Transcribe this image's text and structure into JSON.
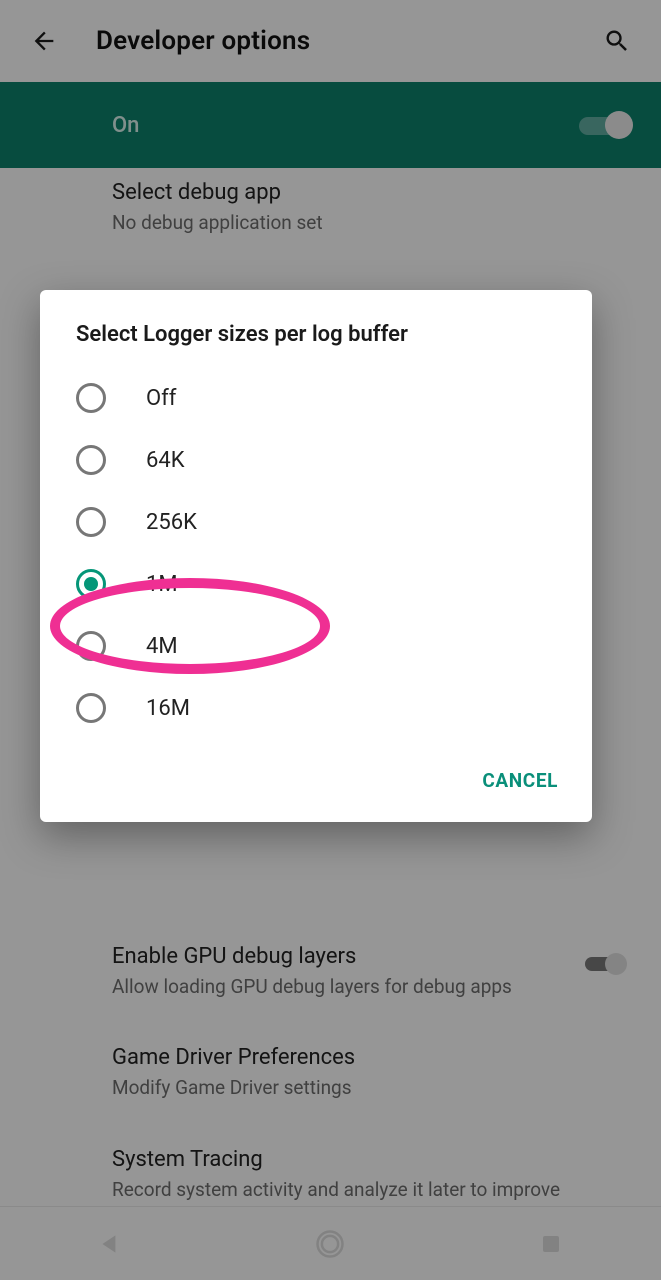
{
  "header": {
    "title": "Developer options"
  },
  "master_toggle": {
    "label": "On",
    "enabled": true
  },
  "settings": {
    "debug_app": {
      "title": "Select debug app",
      "subtitle": "No debug application set"
    },
    "gpu_layers": {
      "title": "Enable GPU debug layers",
      "subtitle": "Allow loading GPU debug layers for debug apps",
      "enabled": false
    },
    "game_driver": {
      "title": "Game Driver Preferences",
      "subtitle": "Modify Game Driver settings"
    },
    "sys_trace": {
      "title": "System Tracing",
      "subtitle": "Record system activity and analyze it later to improve performance"
    }
  },
  "dialog": {
    "title": "Select Logger sizes per log buffer",
    "options": [
      {
        "label": "Off",
        "selected": false
      },
      {
        "label": "64K",
        "selected": false
      },
      {
        "label": "256K",
        "selected": false
      },
      {
        "label": "1M",
        "selected": true
      },
      {
        "label": "4M",
        "selected": false
      },
      {
        "label": "16M",
        "selected": false
      }
    ],
    "cancel": "CANCEL"
  }
}
